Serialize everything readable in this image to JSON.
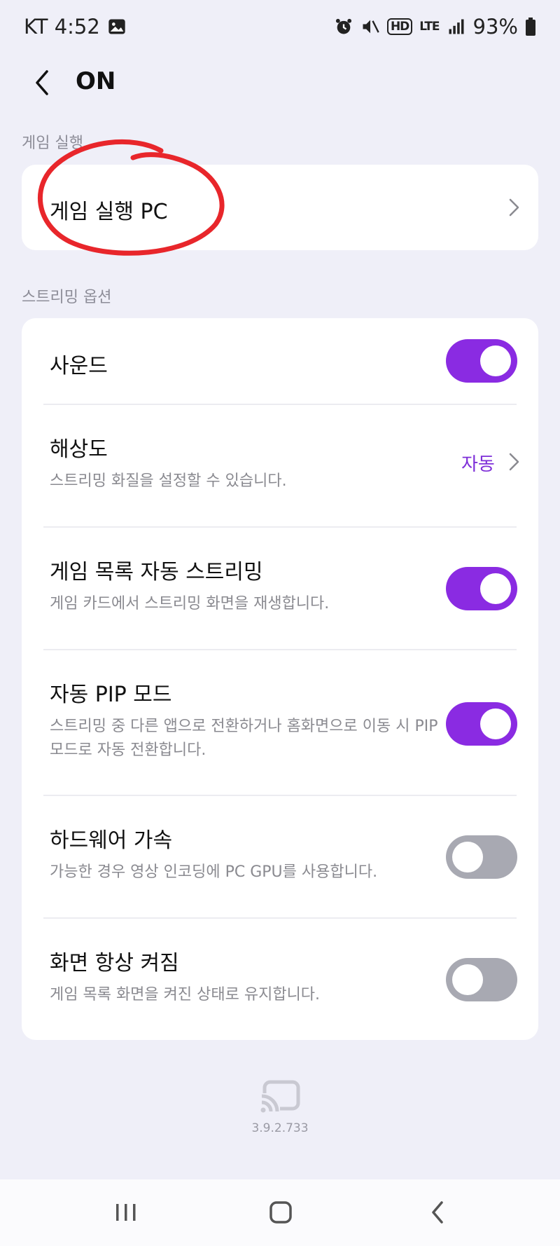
{
  "status_bar": {
    "carrier_time": "KT 4:52",
    "network_hd": "HD",
    "network_lte": "LTE",
    "battery": "93%"
  },
  "header": {
    "title": "ON",
    "back_icon": "back-arrow-icon"
  },
  "sections": {
    "game_launch": {
      "label": "게임 실행",
      "items": [
        {
          "title": "게임 실행 PC"
        }
      ]
    },
    "streaming_options": {
      "label": "스트리밍 옵션",
      "items": [
        {
          "title": "사운드",
          "toggle": true
        },
        {
          "title": "해상도",
          "desc": "스트리밍 화질을 설정할 수 있습니다.",
          "value": "자동"
        },
        {
          "title": "게임 목록 자동 스트리밍",
          "desc": "게임 카드에서 스트리밍 화면을 재생합니다.",
          "toggle": true
        },
        {
          "title": "자동 PIP 모드",
          "desc_line1": "스트리밍 중 다른 앱으로 전환하거나 홈화면으로 이동 시 PIP",
          "desc_line2": "모드로 자동 전환합니다.",
          "toggle": true
        },
        {
          "title": "하드웨어 가속",
          "desc": "가능한 경우 영상 인코딩에 PC GPU를 사용합니다.",
          "toggle": false
        },
        {
          "title": "화면 항상 켜짐",
          "desc": "게임 목록 화면을 켜진 상태로 유지합니다.",
          "toggle": false
        }
      ]
    }
  },
  "footer": {
    "version": "3.9.2.733",
    "logo_icon": "cast-icon"
  },
  "colors": {
    "accent": "#8a2be2",
    "toggle_off": "#a8a9b2",
    "background": "#efeff8",
    "annotation": "#e8262b"
  }
}
